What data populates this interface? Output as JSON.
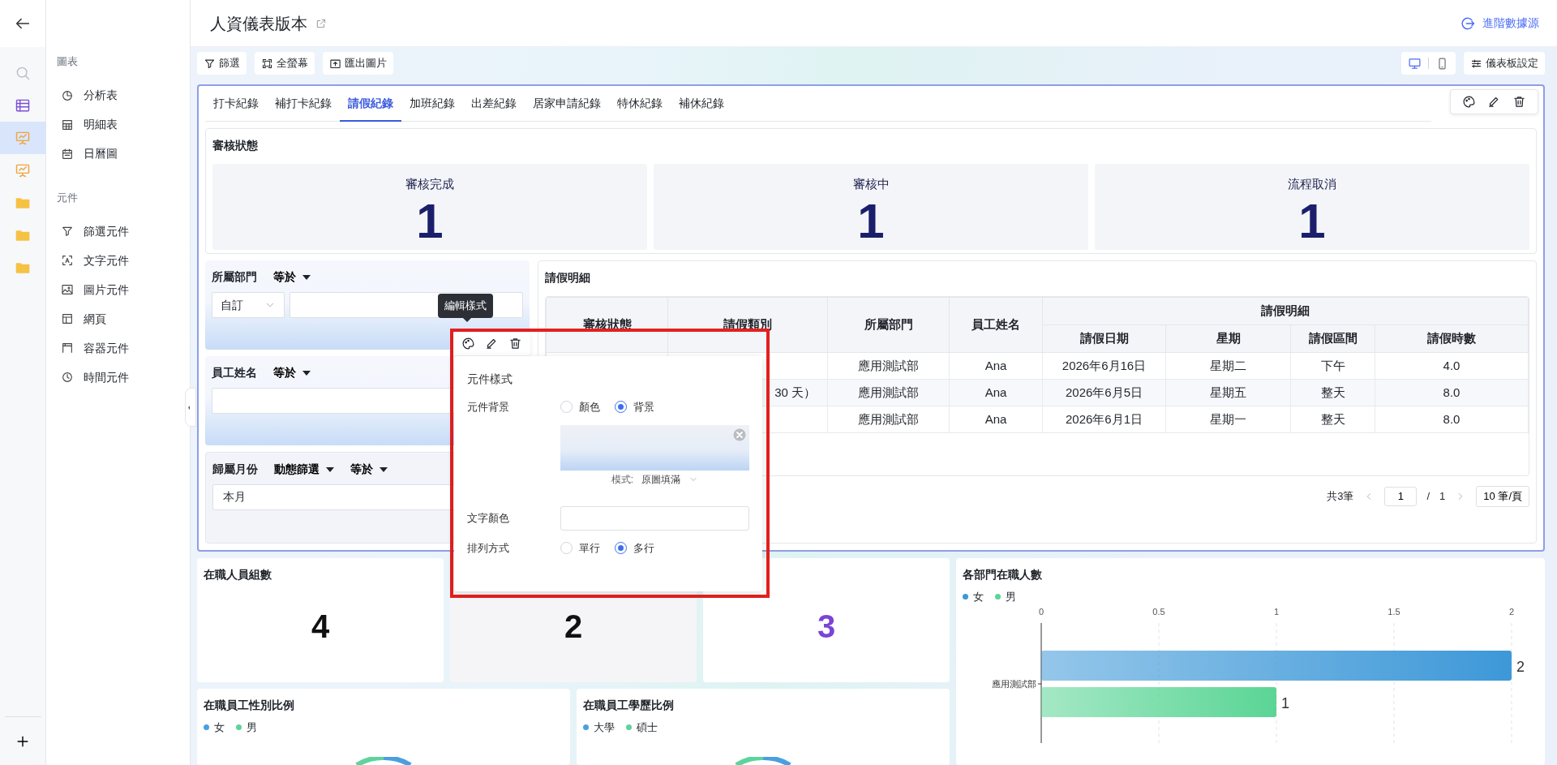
{
  "header": {
    "title": "人資儀表版本",
    "action": "進階數據源"
  },
  "rail": {
    "items": [
      {
        "kind": "search",
        "selected": false
      },
      {
        "kind": "table",
        "selected": false
      },
      {
        "kind": "board",
        "selected": true
      },
      {
        "kind": "board",
        "selected": false
      },
      {
        "kind": "folder",
        "selected": false
      },
      {
        "kind": "folder",
        "selected": false
      },
      {
        "kind": "folder",
        "selected": false
      }
    ]
  },
  "sidebar": {
    "sections": [
      {
        "title": "圖表",
        "items": [
          {
            "label": "分析表",
            "kind": "pie"
          },
          {
            "label": "明細表",
            "kind": "grid"
          },
          {
            "label": "日曆圖",
            "kind": "calendar"
          }
        ]
      },
      {
        "title": "元件",
        "items": [
          {
            "label": "篩選元件",
            "kind": "filter"
          },
          {
            "label": "文字元件",
            "kind": "text"
          },
          {
            "label": "圖片元件",
            "kind": "image"
          },
          {
            "label": "網頁",
            "kind": "webpage"
          },
          {
            "label": "容器元件",
            "kind": "container"
          },
          {
            "label": "時間元件",
            "kind": "clock"
          }
        ]
      }
    ]
  },
  "toolbar": {
    "buttons": [
      {
        "label": "篩選",
        "kind": "filter"
      },
      {
        "label": "全螢幕",
        "kind": "fullscreen"
      },
      {
        "label": "匯出圖片",
        "kind": "export"
      }
    ],
    "views": [
      {
        "kind": "desktop",
        "selected": true
      },
      {
        "kind": "mobile",
        "selected": false
      }
    ],
    "settings": "儀表板設定"
  },
  "tabs": [
    {
      "label": "打卡紀錄",
      "selected": false
    },
    {
      "label": "補打卡紀錄",
      "selected": false
    },
    {
      "label": "請假紀錄",
      "selected": true
    },
    {
      "label": "加班紀錄",
      "selected": false
    },
    {
      "label": "出差紀錄",
      "selected": false
    },
    {
      "label": "居家申請紀錄",
      "selected": false
    },
    {
      "label": "特休紀錄",
      "selected": false
    },
    {
      "label": "補休紀錄",
      "selected": false
    }
  ],
  "status_panel": {
    "title": "審核狀態",
    "cards": [
      {
        "label": "審核完成",
        "value": "1"
      },
      {
        "label": "審核中",
        "value": "1"
      },
      {
        "label": "流程取消",
        "value": "1"
      }
    ]
  },
  "filters": [
    {
      "label": "所屬部門",
      "dropdowns": [
        "等於"
      ],
      "fields": [
        {
          "kind": "select",
          "value": "自訂"
        },
        {
          "kind": "input"
        }
      ]
    },
    {
      "label": "員工姓名",
      "dropdowns": [
        "等於"
      ],
      "fields": [
        {
          "kind": "input"
        }
      ]
    },
    {
      "label": "歸屬月份",
      "dropdowns": [
        "動態篩選",
        "等於"
      ],
      "fields": [
        {
          "kind": "input",
          "value": "本月"
        }
      ]
    }
  ],
  "leave_table": {
    "title": "請假明細",
    "columns": [
      "審核狀態",
      "請假類別",
      "所屬部門",
      "員工姓名"
    ],
    "group": {
      "title": "請假明細",
      "columns": [
        "請假日期",
        "星期",
        "請假區間",
        "請假時數"
      ]
    },
    "rows": [
      {
        "department": "應用測試部",
        "name": "Ana",
        "date": "2026年6月16日",
        "weekday": "星期二",
        "period": "下午",
        "hours": "4.0"
      },
      {
        "leave_type": "30 天）",
        "department": "應用測試部",
        "name": "Ana",
        "date": "2026年6月5日",
        "weekday": "星期五",
        "period": "整天",
        "hours": "8.0"
      },
      {
        "department": "應用測試部",
        "name": "Ana",
        "date": "2026年6月1日",
        "weekday": "星期一",
        "period": "整天",
        "hours": "8.0"
      }
    ]
  },
  "pagination": {
    "total": "共3筆",
    "page": "1",
    "separator": "/",
    "pages": "1",
    "page_size": "10 筆/頁"
  },
  "tooltip": "編輯樣式",
  "style_popup": {
    "title": "元件樣式",
    "rows": [
      {
        "kind": "radio",
        "label": "元件背景",
        "options": [
          {
            "label": "顏色",
            "selected": false
          },
          {
            "label": "背景",
            "selected": true
          }
        ]
      },
      {
        "kind": "image",
        "mode_label": "模式:",
        "mode": "原圖填滿"
      },
      {
        "kind": "input",
        "label": "文字顏色"
      },
      {
        "kind": "radio",
        "label": "排列方式",
        "options": [
          {
            "label": "單行",
            "selected": false
          },
          {
            "label": "多行",
            "selected": true
          }
        ]
      }
    ]
  },
  "kpi_cards": [
    {
      "kind": "plain",
      "title": "在職人員組數",
      "value": "4"
    },
    {
      "kind": "muted",
      "value": "2"
    },
    {
      "kind": "accent",
      "value": "3"
    }
  ],
  "dept_chart": {
    "title": "各部門在職人數",
    "chart_data": {
      "type": "bar",
      "orientation": "horizontal",
      "categories": [
        "應用測試部"
      ],
      "series": [
        {
          "name": "女",
          "color": "#3d98d8",
          "values": [
            2
          ]
        },
        {
          "name": "男",
          "color": "#5ad595",
          "values": [
            1
          ]
        }
      ],
      "xlim": [
        0,
        2
      ],
      "xticks": [
        0,
        0.5,
        1,
        1.5,
        2
      ],
      "grid": true,
      "data_labels": true
    }
  },
  "pie_cards": [
    {
      "title": "在職員工性別比例",
      "legend": [
        {
          "label": "女",
          "color": "#4a9fe0"
        },
        {
          "label": "男",
          "color": "#5dd39e"
        }
      ]
    },
    {
      "title": "在職員工學歷比例",
      "legend": [
        {
          "label": "大學",
          "color": "#4a9fe0"
        },
        {
          "label": "碩士",
          "color": "#5dd39e"
        }
      ]
    }
  ]
}
